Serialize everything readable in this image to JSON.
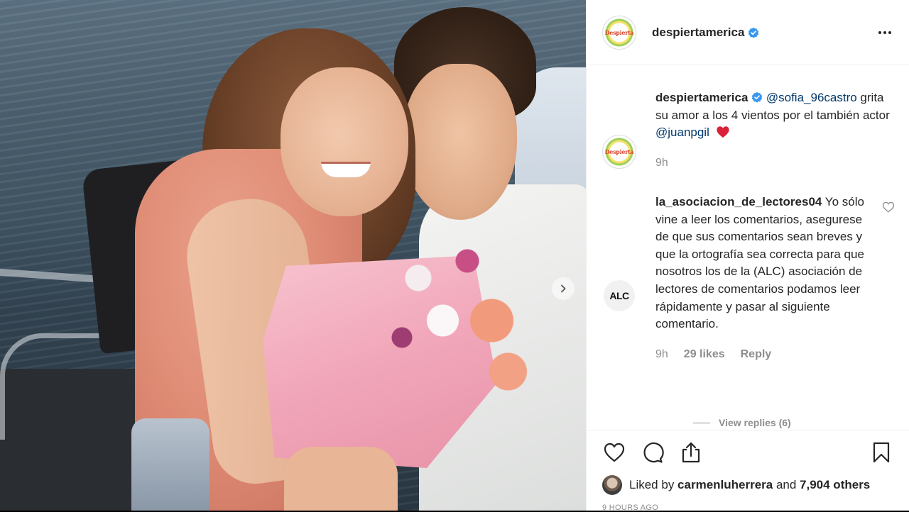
{
  "post": {
    "account": "despiertamerica",
    "avatar_text": "Despierta",
    "verified": true,
    "more_label": "More options"
  },
  "caption": {
    "username": "despiertamerica",
    "mention1": "@sofia_96castro",
    "text1": " grita su amor a los 4 vientos por el también actor ",
    "mention2": "@juanpgil",
    "time": "9h"
  },
  "comment": {
    "avatar_text": "ALC",
    "username": "la_asociacion_de_lectores04",
    "text": " Yo sólo vine a leer los comentarios, asegurese de que sus comentarios sean breves y que la ortografía sea correcta para que nosotros los de la (ALC) asociación de lectores de comentarios podamos leer rápidamente y pasar al siguiente comentario.",
    "time": "9h",
    "likes": "29 likes",
    "reply": "Reply",
    "view_replies": "View replies (6)"
  },
  "likes": {
    "prefix": "Liked by ",
    "user": "carmenluherrera",
    "middle": " and ",
    "count": "7,904 others"
  },
  "timestamp": "9 HOURS AGO",
  "icons": {
    "like": "heart-outline-icon",
    "comment": "comment-bubble-icon",
    "share": "share-icon",
    "save": "bookmark-icon",
    "next": "chevron-right-icon"
  },
  "colors": {
    "verified": "#3897f0",
    "mention": "#00376b",
    "heart": "#ed4956",
    "muted": "#8e8e8e",
    "text": "#262626"
  }
}
